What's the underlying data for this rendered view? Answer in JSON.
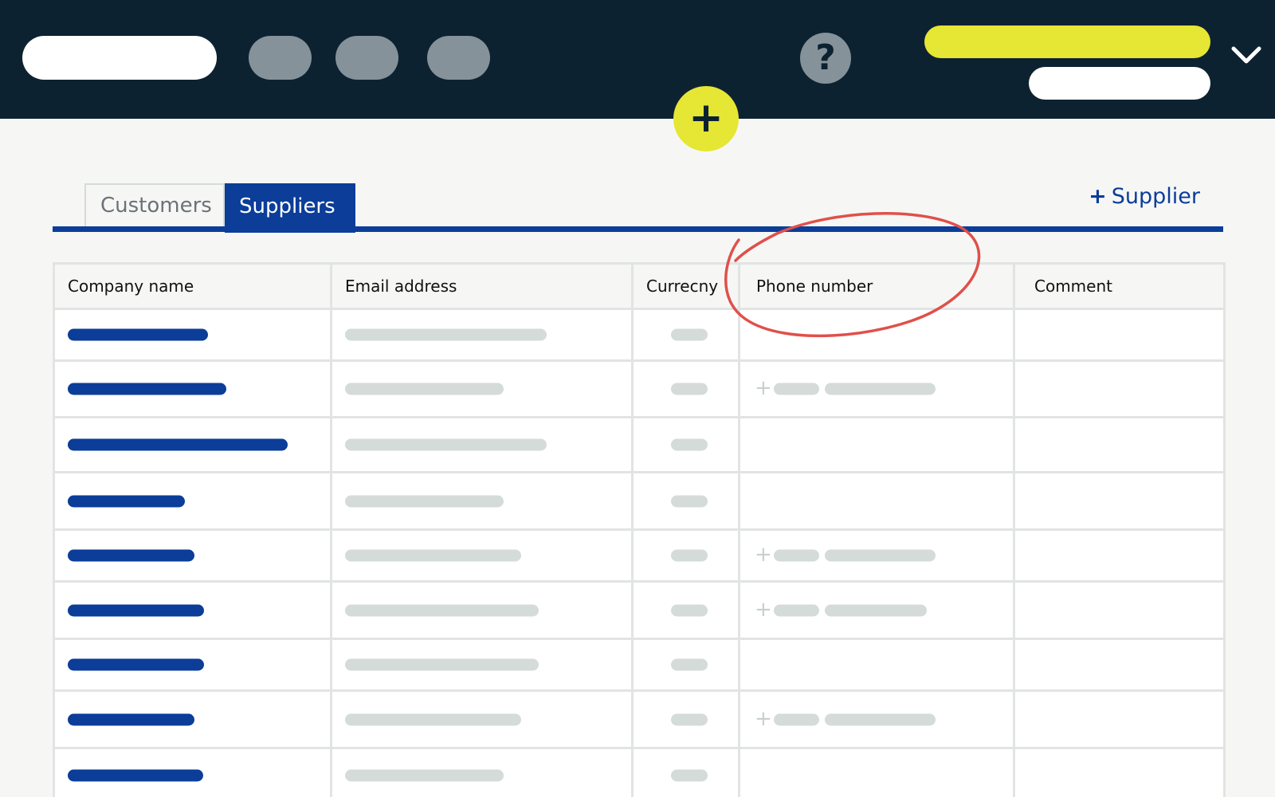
{
  "tabs": {
    "customers": "Customers",
    "suppliers": "Suppliers",
    "active": "Suppliers"
  },
  "actions": {
    "add_supplier_plus": "+",
    "add_supplier_label": "Supplier"
  },
  "header": {
    "help_glyph": "?",
    "fab_glyph": "+"
  },
  "table": {
    "columns": [
      "Company name",
      "Email address",
      "Currecny",
      "Phone number",
      "Comment"
    ],
    "row_count": 9,
    "phone_plus": "+"
  },
  "colors": {
    "topbar": "#0d2231",
    "accent_yellow": "#e6e634",
    "primary_blue": "#0b3d99",
    "placeholder_grey": "#d4dbd8",
    "annotation_red": "#e0504a"
  }
}
